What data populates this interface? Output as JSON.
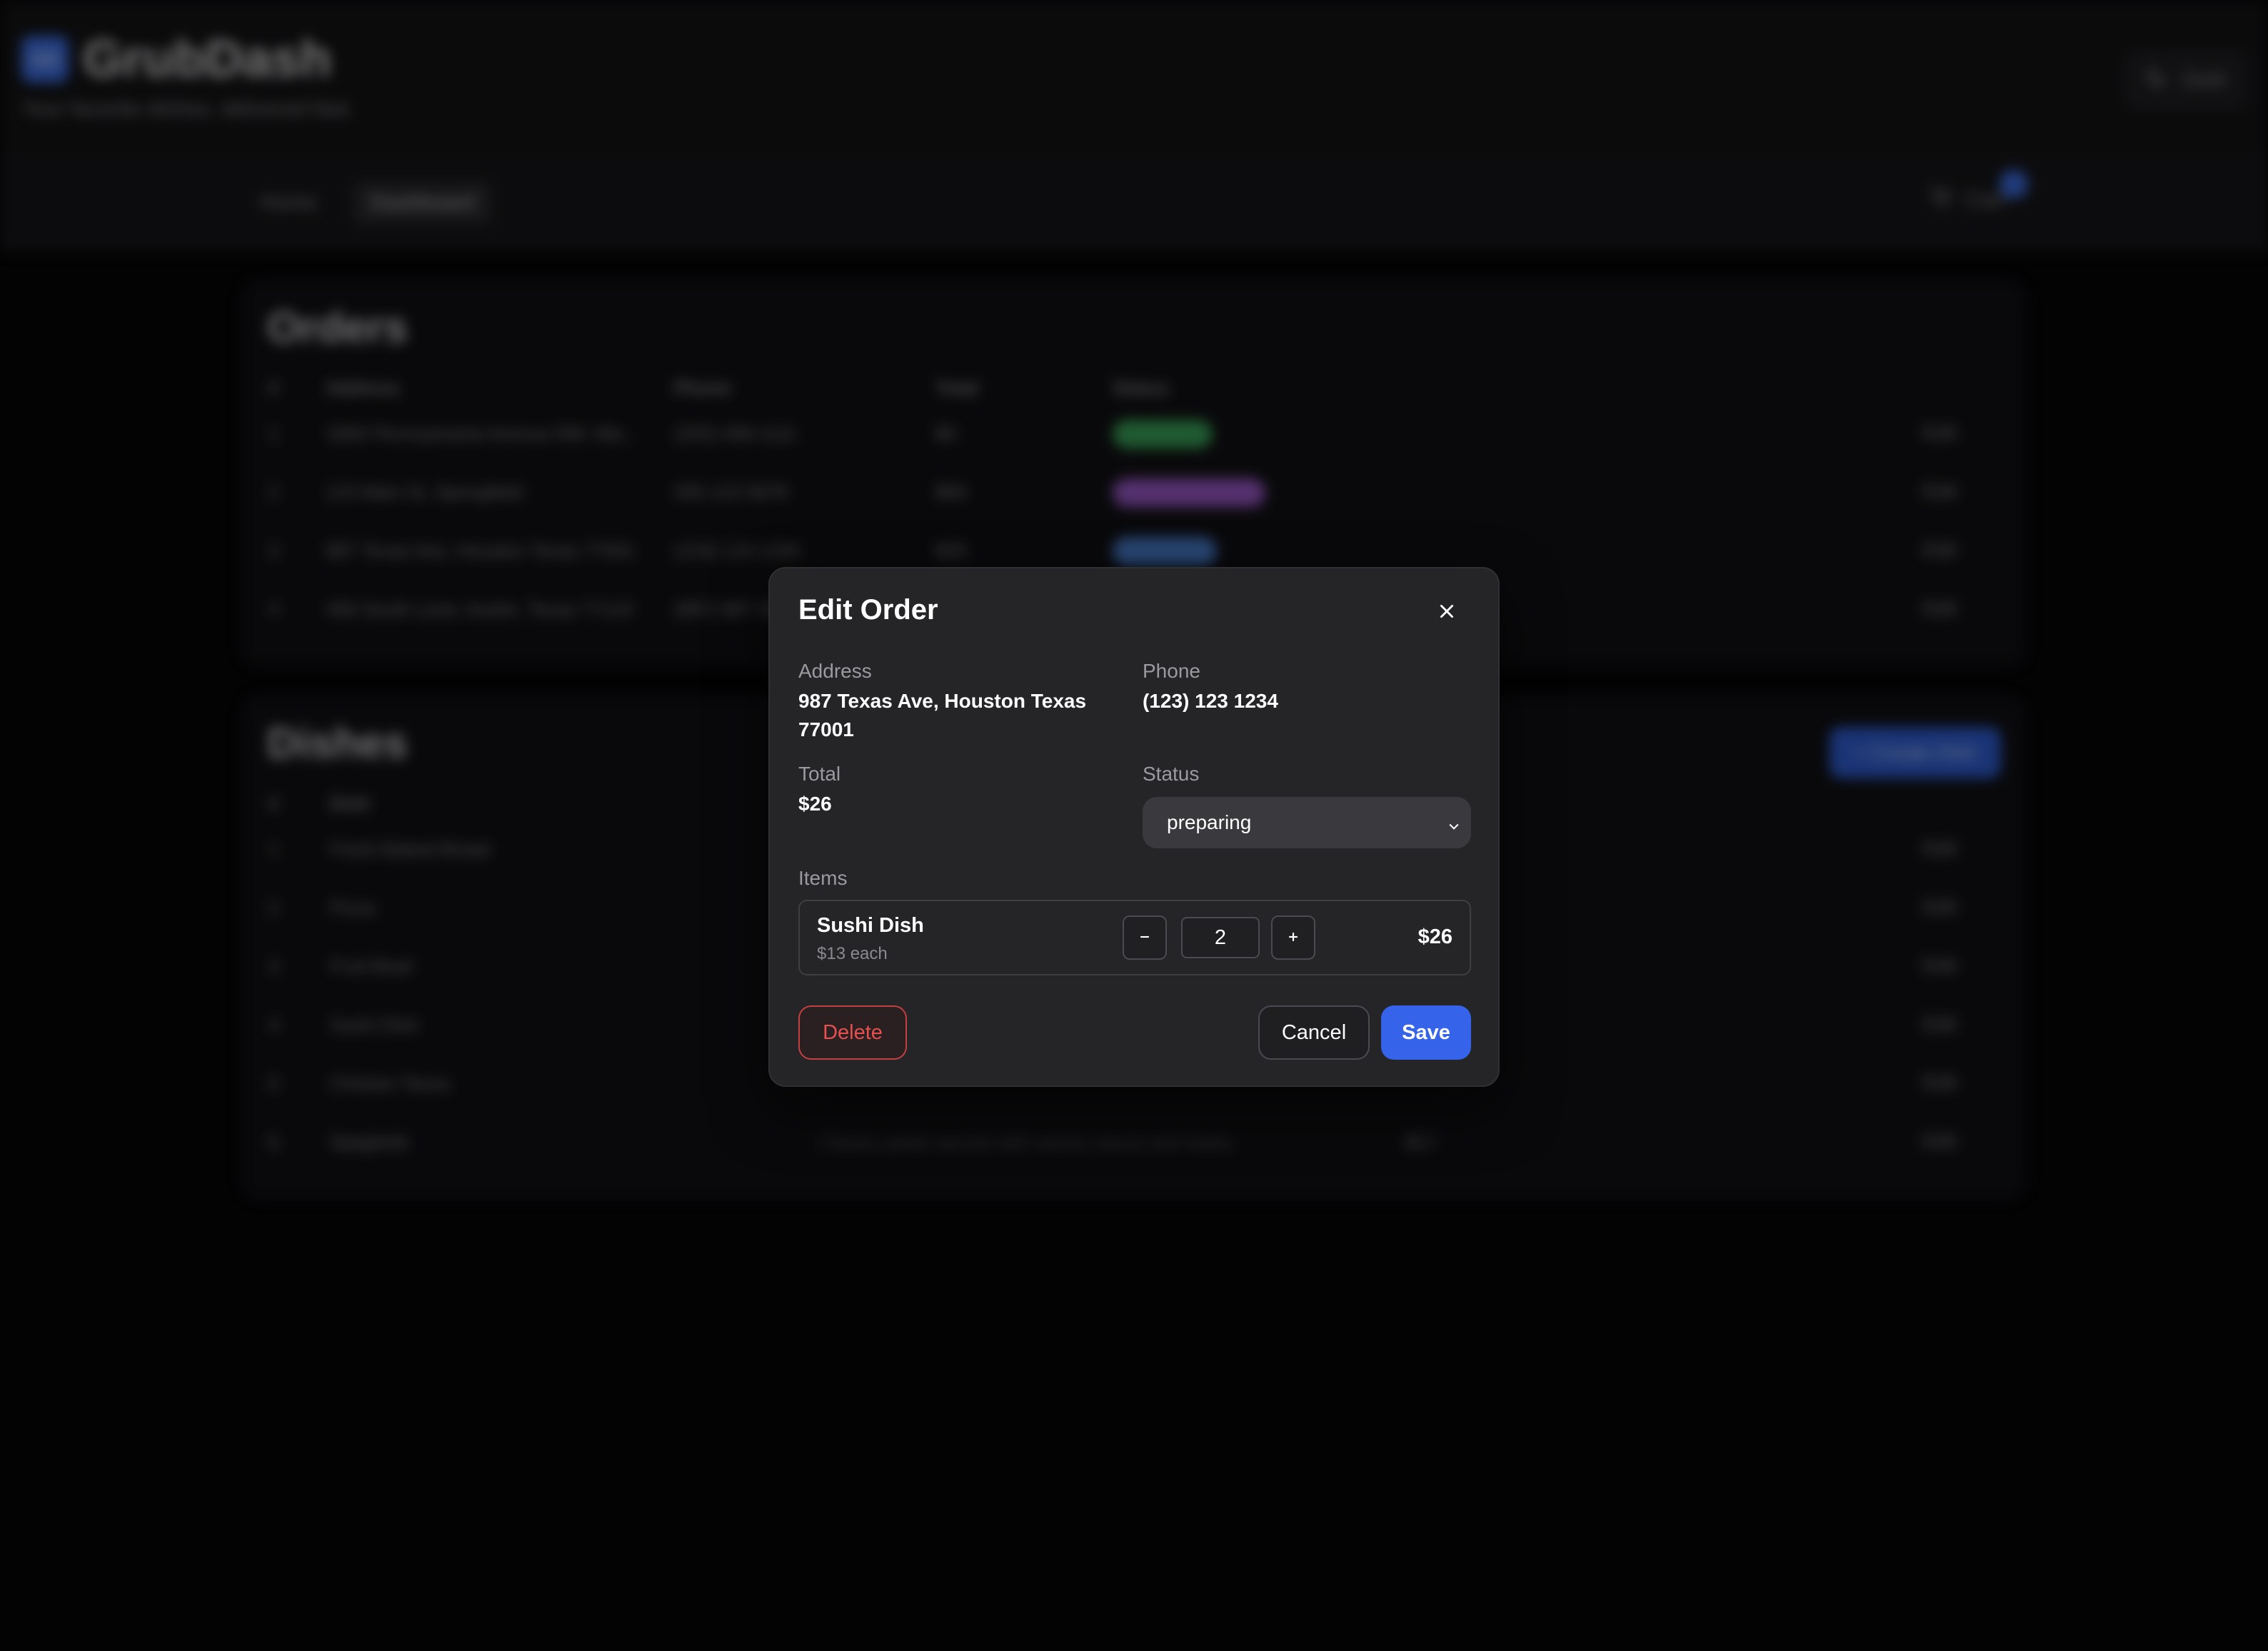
{
  "app": {
    "logo_text": "GD",
    "name": "GrubDash",
    "tagline": "Your favorite dishes, delivered fast.",
    "theme_label": "Dark"
  },
  "nav": {
    "items": [
      {
        "label": "Home",
        "active": false
      },
      {
        "label": "Dashboard",
        "active": true
      }
    ],
    "cart_label": "Cart"
  },
  "orders": {
    "title": "Orders",
    "columns": [
      "#",
      "Address",
      "Phone",
      "Total",
      "Status"
    ],
    "rows": [
      {
        "num": "1",
        "address": "1600 Pennsylvania Avenue NW, Wa...",
        "phone": "(202) 456-1111",
        "total": "$0",
        "status_color": "#3aa55a"
      },
      {
        "num": "2",
        "address": "123 Main St, Springfield",
        "phone": "555 123 5678",
        "total": "$59",
        "status_color": "#9b59c9"
      },
      {
        "num": "3",
        "address": "987 Texas Ave, Houston Texas 77001",
        "phone": "(123) 123 1234",
        "total": "$26",
        "status_color": "#4a7fd0"
      },
      {
        "num": "4",
        "address": "456 South Lane, Austin, Texas 77123",
        "phone": "(987) 987 9876",
        "total": "",
        "status_color": ""
      }
    ],
    "edit_label": "Edit"
  },
  "dishes": {
    "title": "Dishes",
    "create_label": "+ Create Dish",
    "columns": [
      "#",
      "Dish"
    ],
    "rows": [
      {
        "num": "1",
        "name": "Fresh Baked Bread",
        "description": "",
        "price": ""
      },
      {
        "num": "2",
        "name": "Pizza",
        "description": "",
        "price": ""
      },
      {
        "num": "3",
        "name": "Fruit Bowl",
        "description": "",
        "price": ""
      },
      {
        "num": "4",
        "name": "Sushi Dish",
        "description": "",
        "price": ""
      },
      {
        "num": "5",
        "name": "Chicken Tacos",
        "description": "",
        "price": ""
      },
      {
        "num": "6",
        "name": "Spaghetti",
        "description": "Classic pasta served with savory sauce and herbs.",
        "price": "$17"
      }
    ],
    "edit_label": "Edit"
  },
  "modal": {
    "title": "Edit Order",
    "address_label": "Address",
    "address_value": "987 Texas Ave, Houston Texas 77001",
    "phone_label": "Phone",
    "phone_value": "(123) 123 1234",
    "total_label": "Total",
    "total_value": "$26",
    "status_label": "Status",
    "status_value": "preparing",
    "items_label": "Items",
    "items": [
      {
        "name": "Sushi Dish",
        "unit_price": "$13 each",
        "quantity": "2",
        "line_total": "$26"
      }
    ],
    "delete_label": "Delete",
    "cancel_label": "Cancel",
    "save_label": "Save"
  },
  "colors": {
    "accent": "#3563e9",
    "danger": "#e85050",
    "modal_bg": "#252528",
    "page_bg": "#060608"
  }
}
